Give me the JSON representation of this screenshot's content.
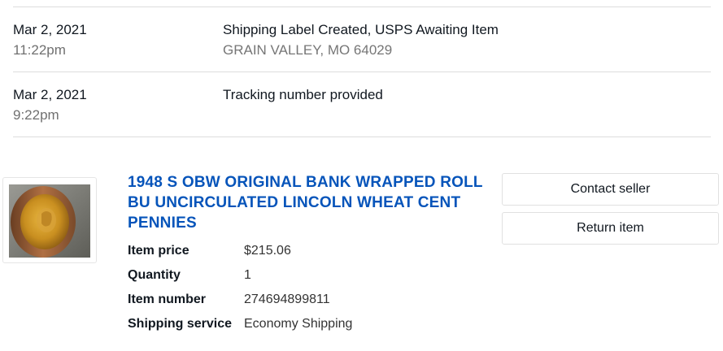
{
  "tracking_events": [
    {
      "date": "Mar 2, 2021",
      "time": "11:22pm",
      "title": "Shipping Label Created, USPS Awaiting Item",
      "location": "GRAIN VALLEY, MO 64029"
    },
    {
      "date": "Mar 2, 2021",
      "time": "9:22pm",
      "title": "Tracking number provided",
      "location": ""
    }
  ],
  "item": {
    "title": "1948 S OBW ORIGINAL BANK WRAPPED ROLL BU UNCIRCULATED LINCOLN WHEAT CENT PENNIES",
    "thumbnail_icon": "coin-roll-photo",
    "details": [
      {
        "label": "Item price",
        "value": "$215.06"
      },
      {
        "label": "Quantity",
        "value": "1"
      },
      {
        "label": "Item number",
        "value": "274694899811"
      },
      {
        "label": "Shipping service",
        "value": "Economy Shipping"
      }
    ]
  },
  "actions": {
    "contact_seller": "Contact seller",
    "return_item": "Return item"
  },
  "colors": {
    "link_blue": "#0654ba",
    "divider": "#dddddd",
    "muted_text": "#767676"
  }
}
